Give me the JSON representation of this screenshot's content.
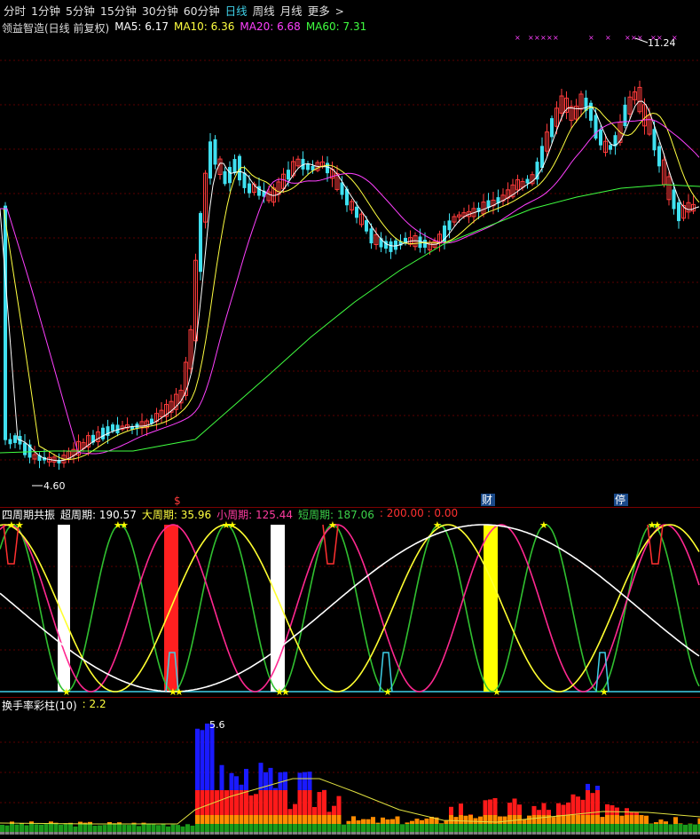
{
  "tabs": [
    {
      "label": "分时",
      "active": false
    },
    {
      "label": "1分钟",
      "active": false
    },
    {
      "label": "5分钟",
      "active": false
    },
    {
      "label": "15分钟",
      "active": false
    },
    {
      "label": "30分钟",
      "active": false
    },
    {
      "label": "60分钟",
      "active": false
    },
    {
      "label": "日线",
      "active": true
    },
    {
      "label": "周线",
      "active": false
    },
    {
      "label": "月线",
      "active": false
    },
    {
      "label": "更多",
      "active": false
    }
  ],
  "main": {
    "title": "领益智造(日线 前复权)",
    "ma5": "MA5: 6.17",
    "ma10": "MA10: 6.36",
    "ma20": "MA20: 6.68",
    "ma60": "MA60: 7.31",
    "high_label": "11.24",
    "low_label": "4.60",
    "markers": [
      "$",
      "财",
      "停"
    ],
    "colors": {
      "up": "#ff3b3b",
      "down": "#3fe0f0",
      "ma5": "#ffffff",
      "ma10": "#ffff40",
      "ma20": "#ff40ff",
      "ma60": "#40ff40"
    }
  },
  "cycle": {
    "title": "四周期共振",
    "super_label": "超周期:",
    "super_value": "190.57",
    "big_label": "大周期:",
    "big_value": "35.96",
    "small_label": "小周期:",
    "small_value": "125.44",
    "short_label": "短周期:",
    "short_value": "187.06",
    "extra": ": 200.00 : 0.00"
  },
  "turnover": {
    "title": "换手率彩柱(10)",
    "value": ": 2.2",
    "peak_label": "5.6"
  },
  "chart_data": {
    "type": "candlestick",
    "price_range": [
      4.6,
      11.24
    ],
    "high": 11.24,
    "low": 4.6,
    "moving_averages": {
      "MA5": 6.17,
      "MA10": 6.36,
      "MA20": 6.68,
      "MA60": 7.31
    },
    "turnover_peak": 5.6,
    "turnover_current": 2.2
  }
}
